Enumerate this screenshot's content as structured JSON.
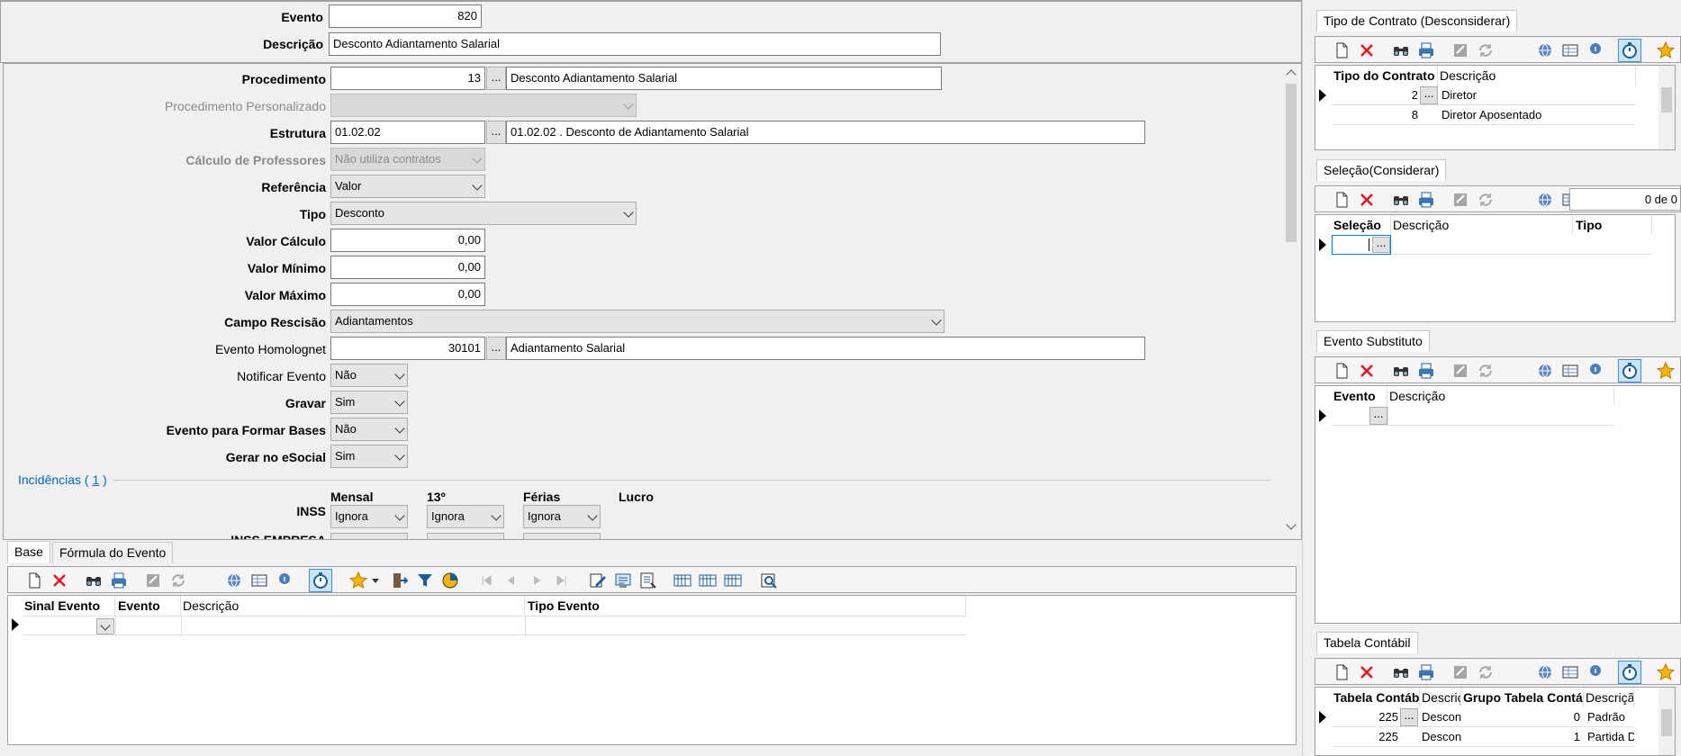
{
  "header": {
    "evento_label": "Evento",
    "evento_value": "820",
    "descricao_label": "Descrição",
    "descricao_value": "Desconto Adiantamento Salarial"
  },
  "form": {
    "procedimento_label": "Procedimento",
    "procedimento_code": "13",
    "procedimento_desc": "Desconto Adiantamento Salarial",
    "proc_pers_label": "Procedimento Personalizado",
    "estrutura_label": "Estrutura",
    "estrutura_code": "01.02.02",
    "estrutura_desc": "01.02.02  .  Desconto de Adiantamento Salarial",
    "calc_prof_label": "Cálculo de Professores",
    "calc_prof_value": "Não utiliza contratos",
    "referencia_label": "Referência",
    "referencia_value": "Valor",
    "tipo_label": "Tipo",
    "tipo_value": "Desconto",
    "valor_calculo_label": "Valor Cálculo",
    "valor_calculo_value": "0,00",
    "valor_minimo_label": "Valor Mínimo",
    "valor_minimo_value": "0,00",
    "valor_maximo_label": "Valor Máximo",
    "valor_maximo_value": "0,00",
    "campo_rescisao_label": "Campo Rescisão",
    "campo_rescisao_value": "Adiantamentos",
    "evento_homolognet_label": "Evento Homolognet",
    "evento_homolognet_code": "30101",
    "evento_homolognet_desc": "Adiantamento Salarial",
    "notificar_label": "Notificar Evento",
    "notificar_value": "Não",
    "gravar_label": "Gravar",
    "gravar_value": "Sim",
    "formar_bases_label": "Evento para Formar Bases",
    "formar_bases_value": "Não",
    "esocial_label": "Gerar no eSocial",
    "esocial_value": "Sim",
    "dots": "...",
    "incidencias_label": "Incidências (",
    "incidencias_count": "1",
    "incidencias_close": ")",
    "inc_cols": [
      "Mensal",
      "13º",
      "Férias",
      "Lucro"
    ],
    "inss_label": "INSS",
    "inss_values": [
      "Ignora",
      "Ignora",
      "Ignora"
    ],
    "inss_empresa_label": "INSS EMPRESA"
  },
  "bottom": {
    "tabs": [
      "Base",
      "Fórmula do Evento"
    ],
    "columns": [
      "Sinal Evento",
      "Evento",
      "Descrição",
      "Tipo Evento"
    ]
  },
  "right": {
    "tipo_contrato": {
      "tab": "Tipo de Contrato (Desconsiderar)",
      "columns": [
        "Tipo do Contrato",
        "Descrição"
      ],
      "rows": [
        {
          "code": "2",
          "desc": "Diretor"
        },
        {
          "code": "8",
          "desc": "Diretor Aposentado"
        }
      ]
    },
    "selecao": {
      "tab": "Seleção(Considerar)",
      "counter": "0 de 0",
      "columns": [
        "Seleção",
        "Descrição",
        "Tipo"
      ]
    },
    "evento_substituto": {
      "tab": "Evento Substituto",
      "columns": [
        "Evento",
        "Descrição"
      ]
    },
    "tabela_contabil": {
      "tab": "Tabela Contábil",
      "columns": [
        "Tabela Contábil",
        "Descrição",
        "Grupo Tabela Contábil",
        "Descrição"
      ],
      "rows": [
        {
          "tabela": "225",
          "desc": "Desconto",
          "grupo": "0",
          "gdesc": "Padrão"
        },
        {
          "tabela": "225",
          "desc": "Desconto",
          "grupo": "1",
          "gdesc": "Partida Dobrada"
        }
      ]
    }
  },
  "colors": {
    "accent": "#0078d7",
    "link": "#0066cc",
    "delete": "#e81123"
  }
}
